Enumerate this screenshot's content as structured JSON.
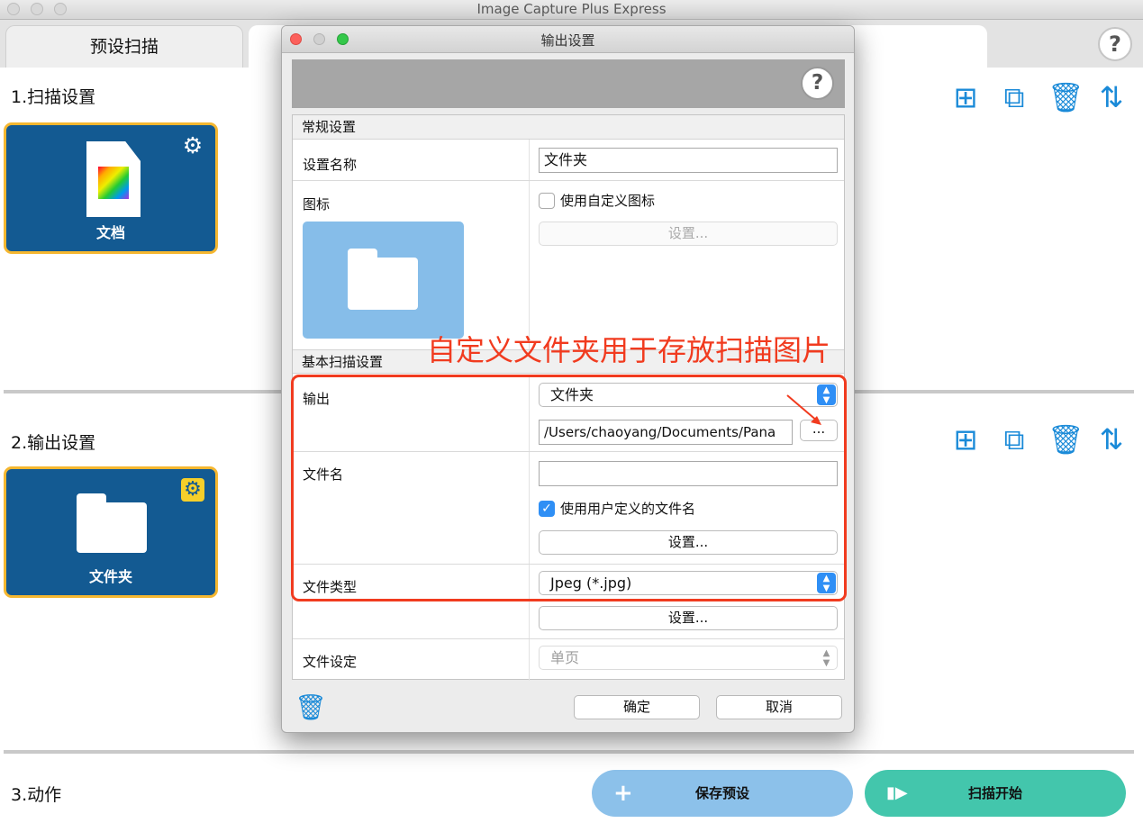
{
  "window": {
    "title": "Image Capture Plus Express"
  },
  "tabs": {
    "preset": "预设扫描"
  },
  "sections": {
    "scan": "1.扫描设置",
    "output": "2.输出设置",
    "action": "3.动作"
  },
  "cards": {
    "scan": {
      "name": "文档",
      "icon": "document-icon"
    },
    "output": {
      "name": "文件夹",
      "icon": "folder-icon"
    }
  },
  "actions": {
    "save": "保存预设",
    "scan_start": "扫描开始"
  },
  "dialog": {
    "title": "输出设置",
    "general": {
      "header": "常规设置",
      "name_label": "设置名称",
      "name_value": "文件夹",
      "icon_label": "图标",
      "custom_icon_checkbox": "使用自定义图标",
      "custom_icon_checked": false,
      "icon_settings_button": "设置..."
    },
    "basic": {
      "header": "基本扫描设置",
      "output_label": "输出",
      "output_value": "文件夹",
      "output_path": "/Users/chaoyang/Documents/Pana",
      "browse_button": "...",
      "filename_label": "文件名",
      "filename_value": "",
      "user_filename_checkbox": "使用用户定义的文件名",
      "user_filename_checked": true,
      "filename_settings_button": "设置...",
      "filetype_label": "文件类型",
      "filetype_value": "Jpeg (*.jpg)",
      "filetype_settings_button": "设置...",
      "filesetting_label": "文件设定",
      "filesetting_value": "单页"
    },
    "ok_button": "确定",
    "cancel_button": "取消"
  },
  "annotation": {
    "text": "自定义文件夹用于存放扫描图片",
    "color": "#f13b1f"
  },
  "colors": {
    "card_bg": "#135a92",
    "card_border": "#f5b730",
    "accent_blue": "#1a8ad8",
    "save_button": "#8cc1ea",
    "scan_button": "#43c6ac"
  }
}
